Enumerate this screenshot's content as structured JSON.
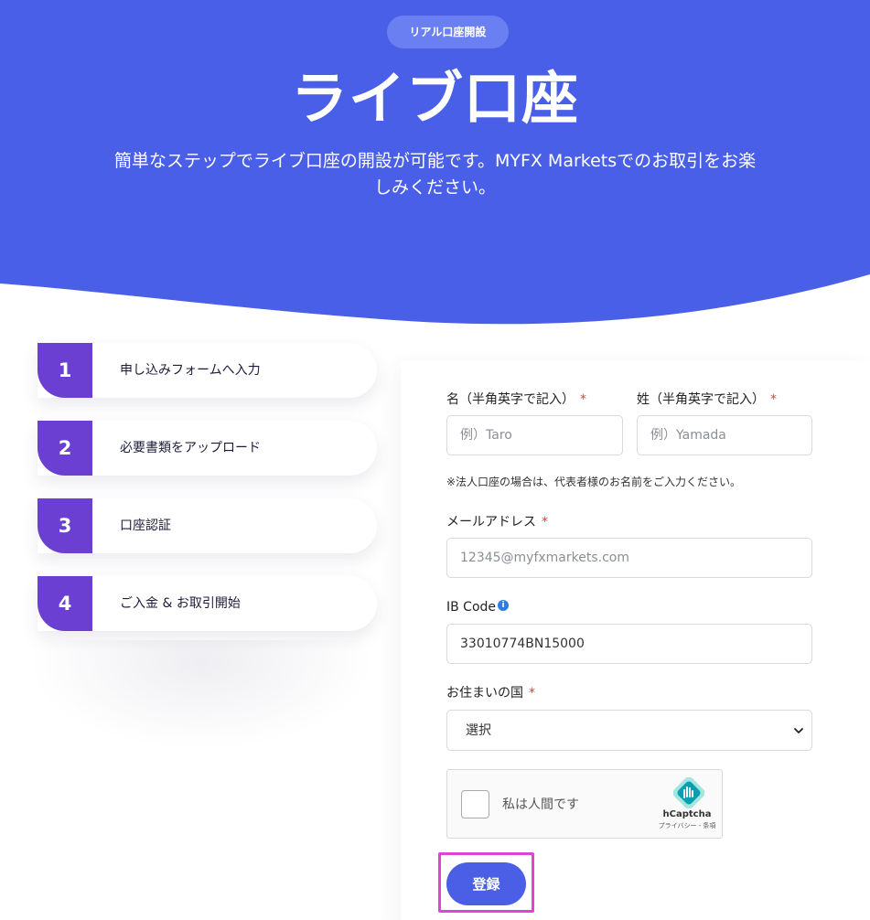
{
  "hero": {
    "badge": "リアル口座開設",
    "title": "ライブ口座",
    "subtitle": "簡単なステップでライブ口座の開設が可能です。MYFX Marketsでのお取引をお楽しみください。",
    "background_color": "#4a5fe8"
  },
  "steps": [
    {
      "number": "1",
      "label": "申し込みフォームへ入力"
    },
    {
      "number": "2",
      "label": "必要書類をアップロード"
    },
    {
      "number": "3",
      "label": "口座認証"
    },
    {
      "number": "4",
      "label": "ご入金 & お取引開始"
    }
  ],
  "form": {
    "first_name": {
      "label": "名（半角英字で記入）",
      "required": "*",
      "placeholder": "例）Taro",
      "value": ""
    },
    "last_name": {
      "label": "姓（半角英字で記入）",
      "required": "*",
      "placeholder": "例）Yamada",
      "value": ""
    },
    "name_note": "※法人口座の場合は、代表者様のお名前をご入力ください。",
    "email": {
      "label": "メールアドレス",
      "required": "*",
      "placeholder": "12345@myfxmarkets.com",
      "value": ""
    },
    "ib_code": {
      "label": "IB Code",
      "info_icon": "i",
      "value": "33010774BN15000"
    },
    "country": {
      "label": "お住まいの国",
      "required": "*",
      "selected": "選択"
    },
    "captcha": {
      "text": "私は人間です",
      "brand": "hCaptcha",
      "links": "プライバシー - 条項"
    },
    "submit_label": "登録"
  },
  "colors": {
    "accent": "#4a5ee6",
    "step_number": "#6a3fd1",
    "required": "#e23b3b",
    "highlight": "#dd45d6"
  }
}
